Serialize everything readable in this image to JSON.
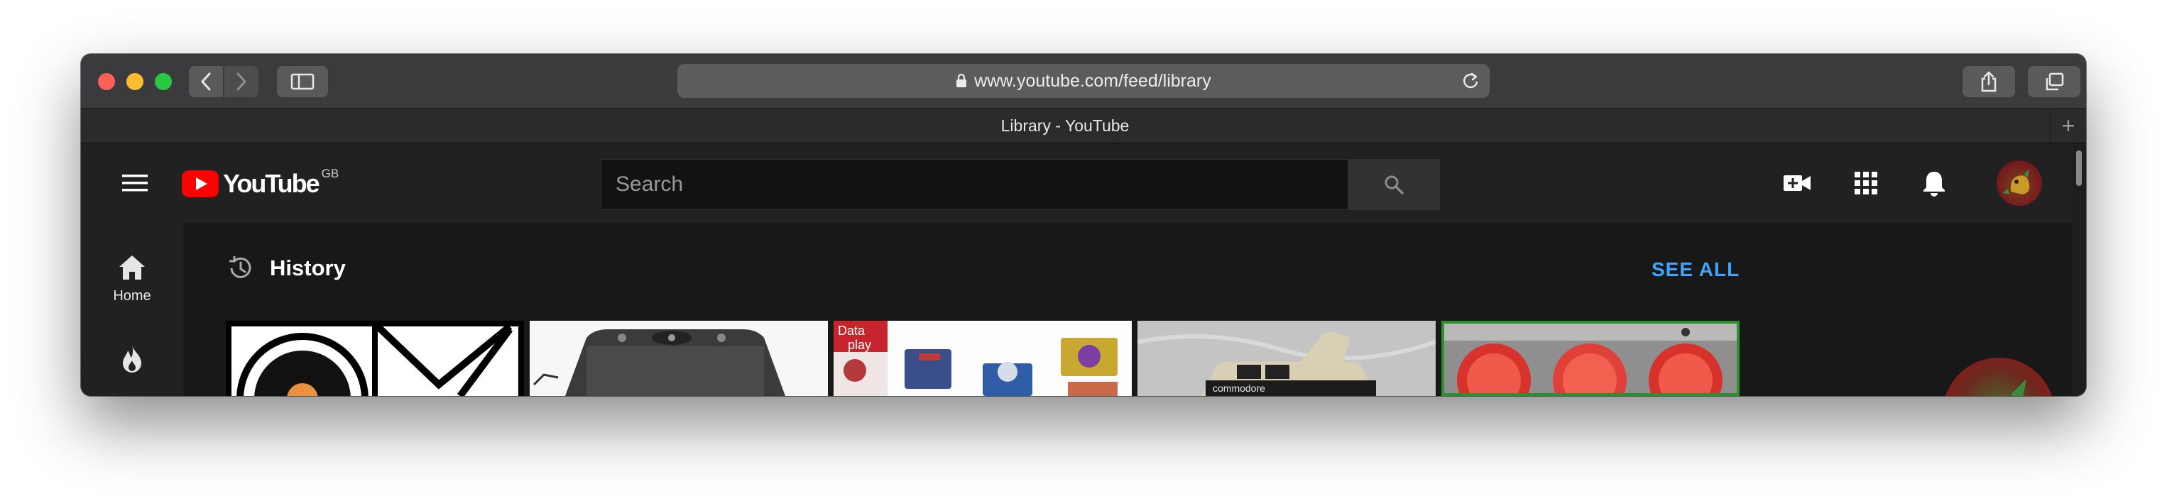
{
  "browser": {
    "url": "www.youtube.com/feed/library",
    "tab_title": "Library - YouTube",
    "new_tab_label": "+"
  },
  "header": {
    "logo_text": "YouTube",
    "logo_region": "GB",
    "search_placeholder": "Search",
    "icons": [
      "menu-icon",
      "create-video-icon",
      "apps-icon",
      "notifications-icon",
      "avatar"
    ]
  },
  "guide": {
    "items": [
      {
        "label": "Home",
        "icon": "home-icon"
      },
      {
        "label": "",
        "icon": "trending-icon"
      }
    ]
  },
  "main": {
    "section_title": "History",
    "see_all": "SEE ALL",
    "thumbnails": [
      {
        "name": "video-thumbnail-vinyl"
      },
      {
        "name": "video-thumbnail-recorder"
      },
      {
        "name": "video-thumbnail-dataplay"
      },
      {
        "name": "video-thumbnail-commodore"
      },
      {
        "name": "video-thumbnail-meters"
      }
    ],
    "thumbnail_texts": {
      "dataplay": "Data\nplay",
      "commodore": "commodore"
    }
  },
  "colors": {
    "accent": "#3ea6ff",
    "youtube_red": "#ff0000",
    "background": "#181818",
    "header": "#212121"
  }
}
